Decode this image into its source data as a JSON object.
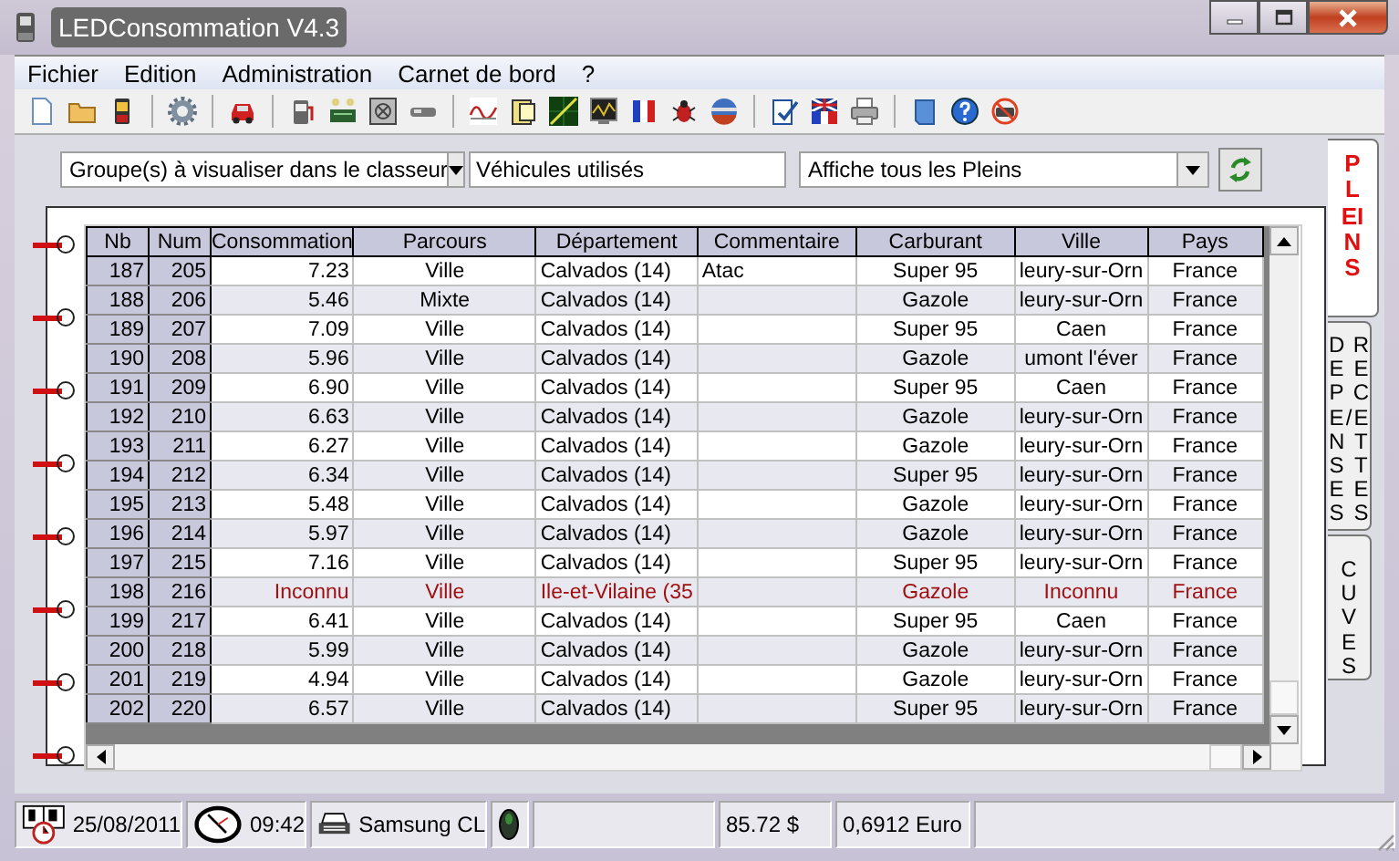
{
  "window": {
    "title": "LEDConsommation V4.3"
  },
  "menu": [
    "Fichier",
    "Edition",
    "Administration",
    "Carnet de bord",
    "?"
  ],
  "filters": {
    "group_select": "Groupe(s) à visualiser dans le classeur",
    "vehicle_field": "Véhicules utilisés",
    "display_select": "Affiche tous les Pleins"
  },
  "table": {
    "columns": [
      "Nb",
      "Num",
      "Consommation",
      "Parcours",
      "Département",
      "Commentaire",
      "Carburant",
      "Ville",
      "Pays"
    ],
    "rows": [
      {
        "cells": [
          "187",
          "205",
          "7.23",
          "Ville",
          "Calvados (14)",
          "Atac",
          "Super 95",
          "leury-sur-Orn",
          "France"
        ],
        "flagged": false
      },
      {
        "cells": [
          "188",
          "206",
          "5.46",
          "Mixte",
          "Calvados (14)",
          "",
          "Gazole",
          "leury-sur-Orn",
          "France"
        ],
        "flagged": false
      },
      {
        "cells": [
          "189",
          "207",
          "7.09",
          "Ville",
          "Calvados (14)",
          "",
          "Super 95",
          "Caen",
          "France"
        ],
        "flagged": false
      },
      {
        "cells": [
          "190",
          "208",
          "5.96",
          "Ville",
          "Calvados (14)",
          "",
          "Gazole",
          "umont l'éver",
          "France"
        ],
        "flagged": false
      },
      {
        "cells": [
          "191",
          "209",
          "6.90",
          "Ville",
          "Calvados (14)",
          "",
          "Super 95",
          "Caen",
          "France"
        ],
        "flagged": false
      },
      {
        "cells": [
          "192",
          "210",
          "6.63",
          "Ville",
          "Calvados (14)",
          "",
          "Gazole",
          "leury-sur-Orn",
          "France"
        ],
        "flagged": false
      },
      {
        "cells": [
          "193",
          "211",
          "6.27",
          "Ville",
          "Calvados (14)",
          "",
          "Gazole",
          "leury-sur-Orn",
          "France"
        ],
        "flagged": false
      },
      {
        "cells": [
          "194",
          "212",
          "6.34",
          "Ville",
          "Calvados (14)",
          "",
          "Super 95",
          "leury-sur-Orn",
          "France"
        ],
        "flagged": false
      },
      {
        "cells": [
          "195",
          "213",
          "5.48",
          "Ville",
          "Calvados (14)",
          "",
          "Gazole",
          "leury-sur-Orn",
          "France"
        ],
        "flagged": false
      },
      {
        "cells": [
          "196",
          "214",
          "5.97",
          "Ville",
          "Calvados (14)",
          "",
          "Gazole",
          "leury-sur-Orn",
          "France"
        ],
        "flagged": false
      },
      {
        "cells": [
          "197",
          "215",
          "7.16",
          "Ville",
          "Calvados (14)",
          "",
          "Super 95",
          "leury-sur-Orn",
          "France"
        ],
        "flagged": false
      },
      {
        "cells": [
          "198",
          "216",
          "Inconnu",
          "Ville",
          "Ile-et-Vilaine (35",
          "",
          "Gazole",
          "Inconnu",
          "France"
        ],
        "flagged": true
      },
      {
        "cells": [
          "199",
          "217",
          "6.41",
          "Ville",
          "Calvados (14)",
          "",
          "Super 95",
          "Caen",
          "France"
        ],
        "flagged": false
      },
      {
        "cells": [
          "200",
          "218",
          "5.99",
          "Ville",
          "Calvados (14)",
          "",
          "Gazole",
          "leury-sur-Orn",
          "France"
        ],
        "flagged": false
      },
      {
        "cells": [
          "201",
          "219",
          "4.94",
          "Ville",
          "Calvados (14)",
          "",
          "Gazole",
          "leury-sur-Orn",
          "France"
        ],
        "flagged": false
      },
      {
        "cells": [
          "202",
          "220",
          "6.57",
          "Ville",
          "Calvados (14)",
          "",
          "Super 95",
          "leury-sur-Orn",
          "France"
        ],
        "flagged": false
      }
    ]
  },
  "tabs": [
    {
      "kind": "single",
      "label": "PLEINS",
      "selected": true
    },
    {
      "kind": "double",
      "label": "DEPENSES",
      "label_2": "RECETTES",
      "separator": "/",
      "selected": false
    },
    {
      "kind": "single",
      "label": "CUVES",
      "selected": false
    }
  ],
  "status_bar": {
    "date": "25/08/2011",
    "time": "09:42",
    "printer": "Samsung CL",
    "amount": "85.72 $",
    "rate": "0,6912 Euro"
  }
}
